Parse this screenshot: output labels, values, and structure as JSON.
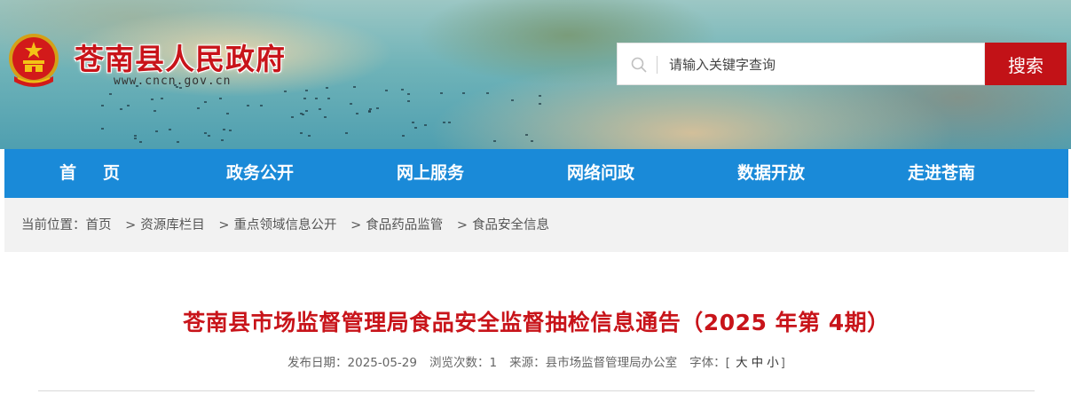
{
  "header": {
    "site_title": "苍南县人民政府",
    "site_url": "www.cncn.gov.cn",
    "search": {
      "placeholder": "请输入关键字查询",
      "value": "",
      "button_label": "搜索"
    }
  },
  "nav": {
    "items": [
      {
        "label": "首页"
      },
      {
        "label": "政务公开"
      },
      {
        "label": "网上服务"
      },
      {
        "label": "网络问政"
      },
      {
        "label": "数据开放"
      },
      {
        "label": "走进苍南"
      }
    ]
  },
  "breadcrumb": {
    "prefix": "当前位置：",
    "items": [
      "首页",
      "资源库栏目",
      "重点领域信息公开",
      "食品药品监管",
      "食品安全信息"
    ],
    "separator": ">"
  },
  "article": {
    "title": "苍南县市场监督管理局食品安全监督抽检信息通告（2025 年第 4期）",
    "publish_label": "发布日期：",
    "publish_date": "2025-05-29",
    "views_label": "浏览次数：",
    "views": "1",
    "source_label": "来源：",
    "source": "县市场监督管理局办公室",
    "font_label": "字体：",
    "font_open": "[",
    "font_large": "大",
    "font_medium": "中",
    "font_small": "小",
    "font_close": "]"
  },
  "colors": {
    "brand_red": "#c8141a",
    "nav_blue": "#1a8ad8",
    "search_button_red": "#c21217",
    "breadcrumb_bg": "#f2f2f2"
  }
}
